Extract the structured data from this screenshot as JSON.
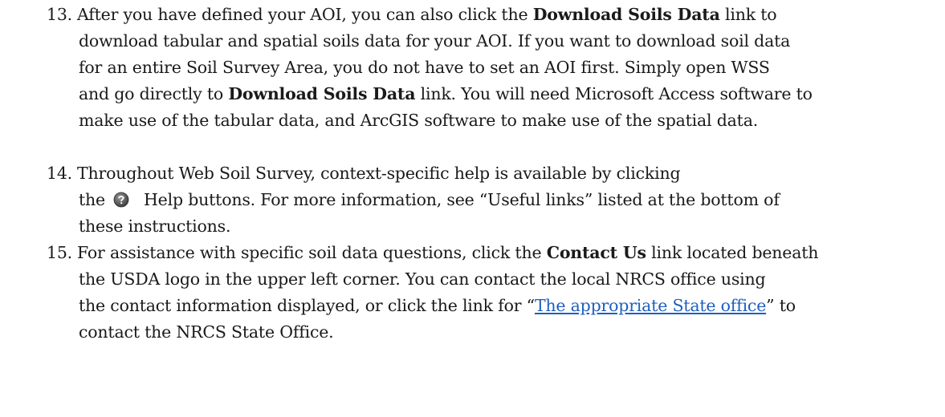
{
  "steps": [
    {
      "number": "13.",
      "lines": [
        [
          "After you have defined your AOI, you can also click the ",
          "Download Soils Data",
          " link to"
        ],
        [
          "download tabular and spatial soils data for your AOI. If you want to download soil data"
        ],
        [
          "for an entire Soil Survey Area, you do not have to set an AOI first. Simply open WSS"
        ],
        [
          "and go directly to ",
          "Download Soils Data",
          " link. You will need Microsoft Access software to"
        ],
        [
          "make use of the tabular data, and ArcGIS software to make use of the spatial data."
        ]
      ]
    },
    {
      "number": "14.",
      "line1": "Throughout Web Soil Survey, context-specific help is available by clicking",
      "line2_pre": "the",
      "line2_post": "Help buttons. For more information, see “Useful links” listed at the bottom of",
      "line3": "these instructions.",
      "help_icon": "question-mark-circle-icon"
    },
    {
      "number": "15.",
      "line1_pre": "For assistance with specific soil data questions, click the ",
      "line1_bold": "Contact Us",
      "line1_post": " link located beneath",
      "line2": "the USDA logo in the upper left corner. You can contact the local NRCS office using",
      "line3": "the contact information displayed, or click the link for “",
      "line3_link": "The appropriate State office",
      "line3_end": "” to",
      "line4": "contact the NRCS State Office."
    }
  ],
  "colors": {
    "text": "#1a1a1a",
    "link": "#1f5fbf"
  }
}
